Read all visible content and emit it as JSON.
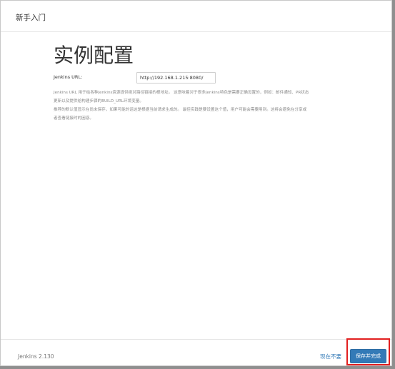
{
  "header": {
    "title": "新手入门"
  },
  "main": {
    "title": "实例配置",
    "url_label": "Jenkins URL:",
    "url_value": "http://192.168.1.215:8080/",
    "help_lines": [
      "Jenkins URL 用于给各种Jenkins资源提供绝对路径链接的根地址。 这意味着对于很多Jenkins特色是需要正确设置的，例如：邮件通知、PR状态",
      "更新以及提供给构建步骤的BUILD_URL环境变量。",
      "推荐的默认值显示在尚未保存，如果可能的话这是根据当前请求生成的。 最佳实践是要设置这个值，用户可能会需要用到。这将会避免在分享或",
      "者查看链接时的困惑。"
    ]
  },
  "footer": {
    "version": "Jenkins 2.130",
    "skip_label": "现在不要",
    "finish_label": "保存并完成"
  },
  "colors": {
    "primary": "#337ab7",
    "highlight": "#e21f1f"
  }
}
